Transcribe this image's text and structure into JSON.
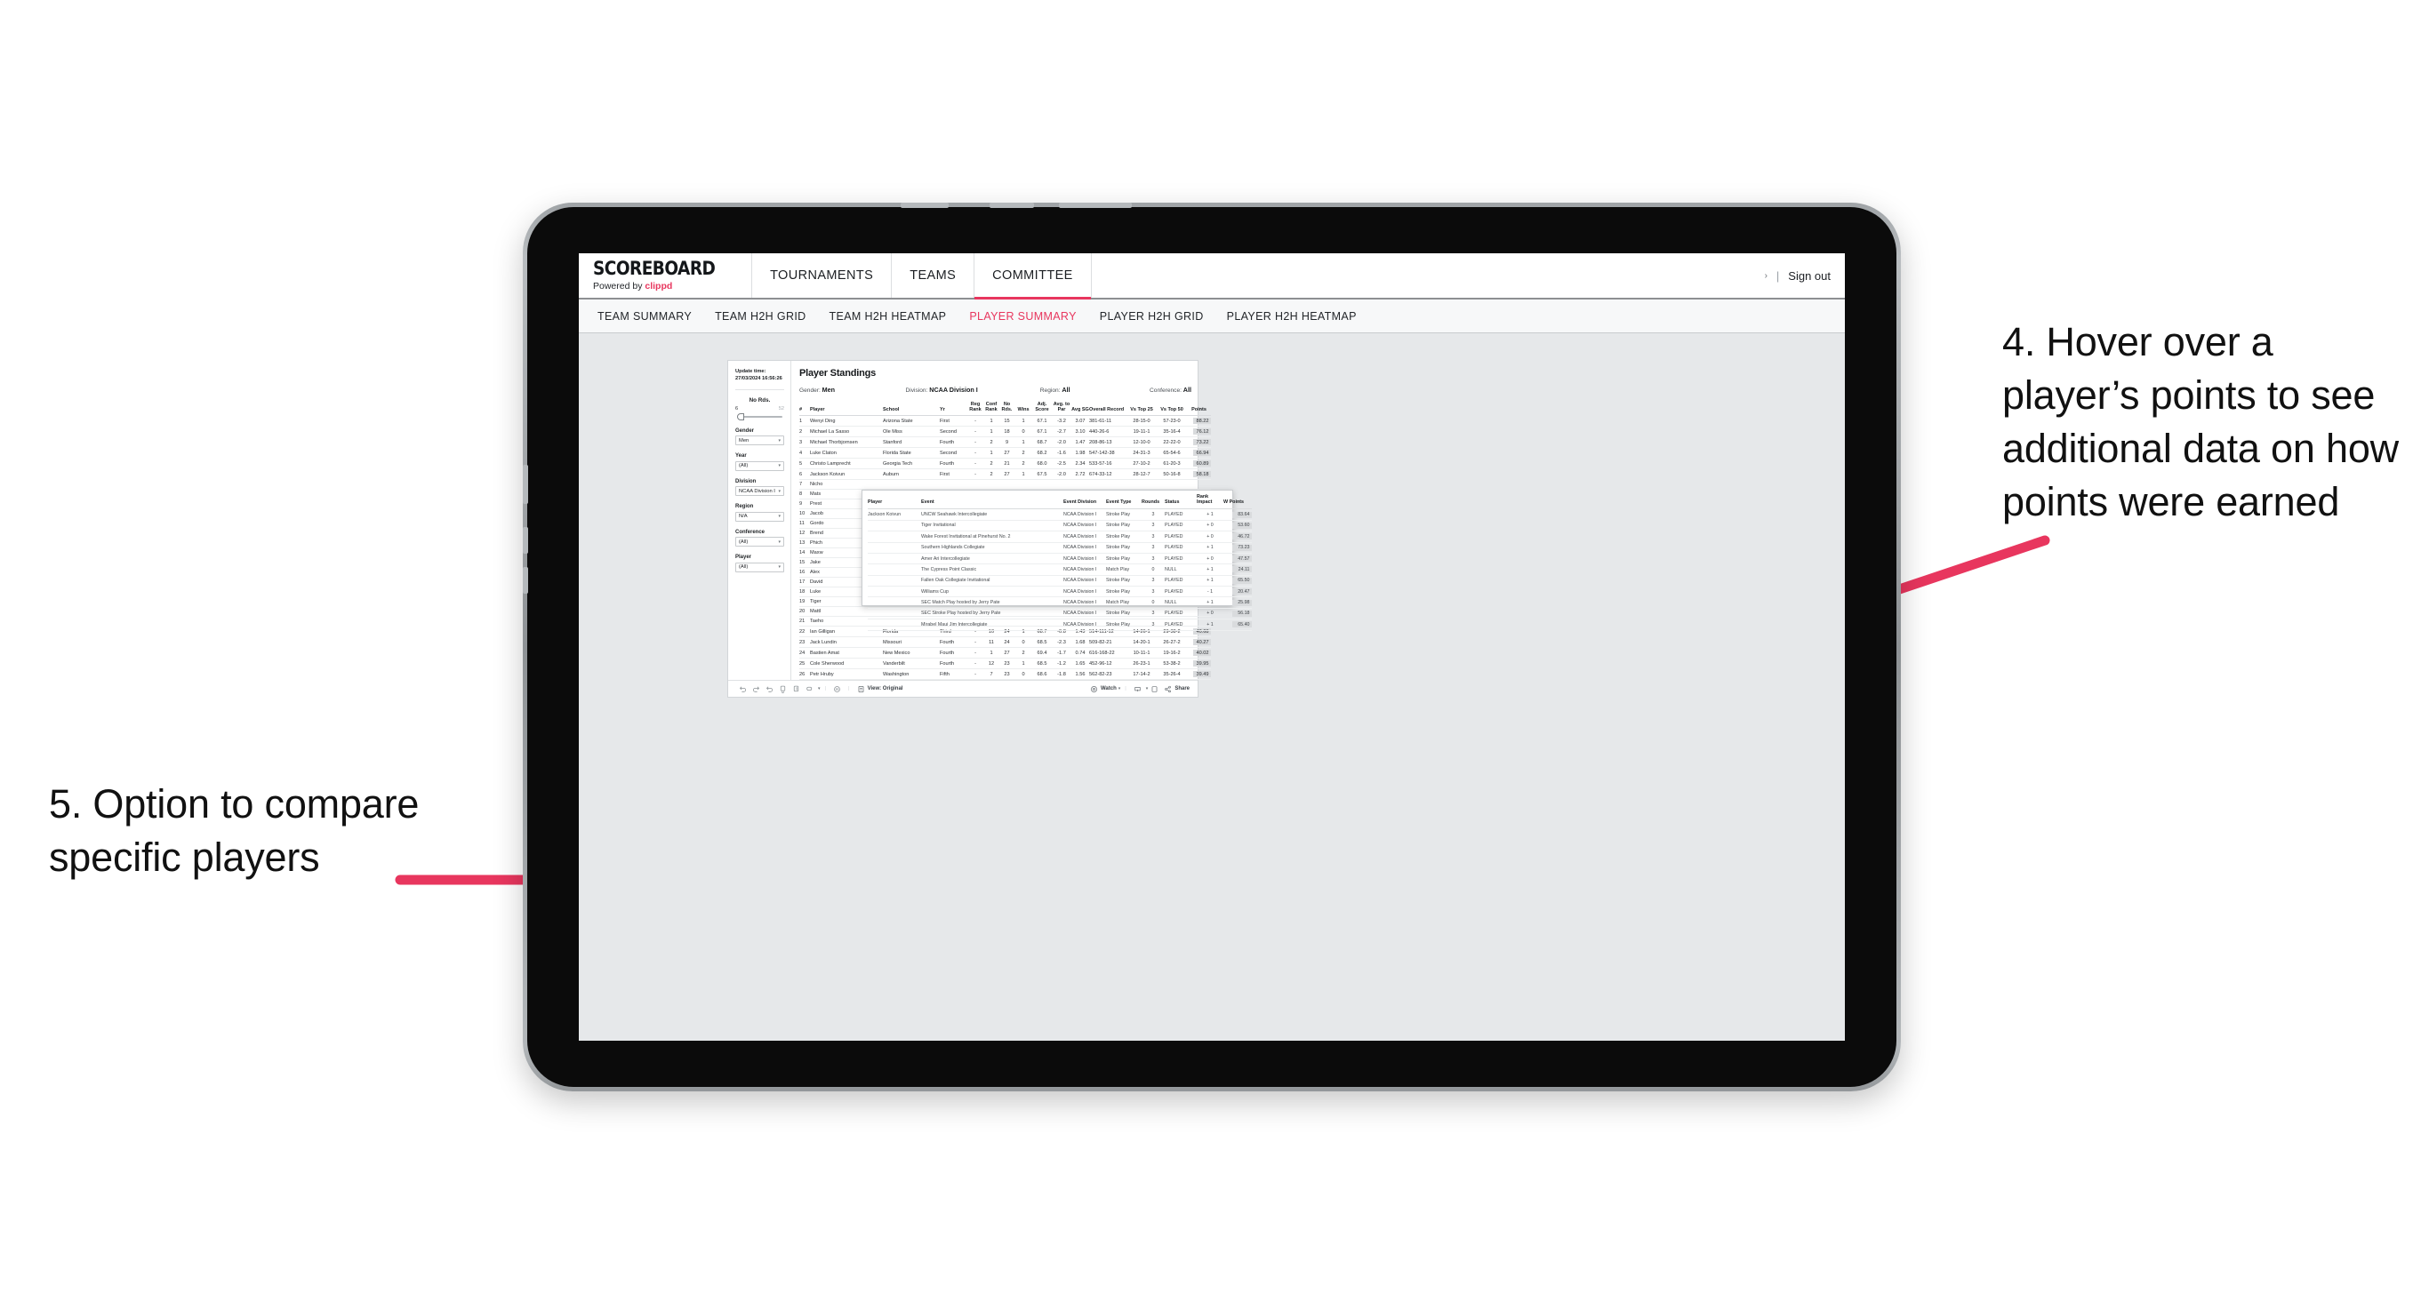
{
  "annotations": {
    "right": "4. Hover over a player’s points to see additional data on how points were earned",
    "left": "5. Option to compare specific players",
    "accent_color": "#E8365E"
  },
  "topnav": {
    "brand_title": "SCOREBOARD",
    "brand_powered": "Powered by",
    "brand_name": "clippd",
    "items": [
      {
        "label": "TOURNAMENTS",
        "active": false
      },
      {
        "label": "TEAMS",
        "active": false
      },
      {
        "label": "COMMITTEE",
        "active": true
      }
    ],
    "caret": "›",
    "separator": "|",
    "signout": "Sign out"
  },
  "subnav": {
    "items": [
      {
        "label": "TEAM SUMMARY",
        "active": false
      },
      {
        "label": "TEAM H2H GRID",
        "active": false
      },
      {
        "label": "TEAM H2H HEATMAP",
        "active": false
      },
      {
        "label": "PLAYER SUMMARY",
        "active": true
      },
      {
        "label": "PLAYER H2H GRID",
        "active": false
      },
      {
        "label": "PLAYER H2H HEATMAP",
        "active": false
      }
    ]
  },
  "filters": {
    "update_time_label": "Update time:",
    "update_time_value": "27/03/2024 16:56:26",
    "slider": {
      "label": "No Rds.",
      "min": "6",
      "max": "52"
    },
    "groups": [
      {
        "label": "Gender",
        "value": "Men"
      },
      {
        "label": "Year",
        "value": "(All)"
      },
      {
        "label": "Division",
        "value": "NCAA Division I"
      },
      {
        "label": "Region",
        "value": "N/A"
      },
      {
        "label": "Conference",
        "value": "(All)"
      },
      {
        "label": "Player",
        "value": "(All)"
      }
    ],
    "caret": "▾"
  },
  "panel": {
    "title": "Player Standings",
    "meta": [
      {
        "label": "Gender:",
        "value": "Men"
      },
      {
        "label": "Division:",
        "value": "NCAA Division I"
      },
      {
        "label": "Region:",
        "value": "All"
      },
      {
        "label": "Conference:",
        "value": "All"
      }
    ]
  },
  "standings": {
    "headers": [
      "#",
      "Player",
      "School",
      "Yr",
      "Reg Rank",
      "Conf Rank",
      "No Rds.",
      "Wins",
      "Adj. Score",
      "Avg. to Par",
      "Avg SG",
      "Overall Record",
      "Vs Top 25",
      "Vs Top 50",
      "Points"
    ],
    "rows": [
      {
        "n": "1",
        "player": "Wenyi Ding",
        "school": "Arizona State",
        "yr": "First",
        "reg": "-",
        "conf": "1",
        "rds": "15",
        "wins": "1",
        "adj": "67.1",
        "par": "-3.2",
        "sg": "3.07",
        "rec": "381-61-11",
        "t25": "28-15-0",
        "t50": "57-23-0",
        "pts": "88.22"
      },
      {
        "n": "2",
        "player": "Michael La Sasso",
        "school": "Ole Miss",
        "yr": "Second",
        "reg": "-",
        "conf": "1",
        "rds": "18",
        "wins": "0",
        "adj": "67.1",
        "par": "-2.7",
        "sg": "3.10",
        "rec": "440-26-6",
        "t25": "19-11-1",
        "t50": "35-16-4",
        "pts": "76.12"
      },
      {
        "n": "3",
        "player": "Michael Thorbjornsen",
        "school": "Stanford",
        "yr": "Fourth",
        "reg": "-",
        "conf": "2",
        "rds": "9",
        "wins": "1",
        "adj": "68.7",
        "par": "-2.0",
        "sg": "1.47",
        "rec": "208-86-13",
        "t25": "12-10-0",
        "t50": "22-22-0",
        "pts": "73.22"
      },
      {
        "n": "4",
        "player": "Luke Claton",
        "school": "Florida State",
        "yr": "Second",
        "reg": "-",
        "conf": "1",
        "rds": "27",
        "wins": "2",
        "adj": "68.2",
        "par": "-1.6",
        "sg": "1.98",
        "rec": "547-142-38",
        "t25": "24-31-3",
        "t50": "65-54-6",
        "pts": "66.94"
      },
      {
        "n": "5",
        "player": "Christo Lamprecht",
        "school": "Georgia Tech",
        "yr": "Fourth",
        "reg": "-",
        "conf": "2",
        "rds": "21",
        "wins": "2",
        "adj": "68.0",
        "par": "-2.5",
        "sg": "2.34",
        "rec": "533-57-16",
        "t25": "27-10-2",
        "t50": "61-20-3",
        "pts": "60.89"
      },
      {
        "n": "6",
        "player": "Jackson Koivun",
        "school": "Auburn",
        "yr": "First",
        "reg": "-",
        "conf": "2",
        "rds": "27",
        "wins": "1",
        "adj": "67.5",
        "par": "-2.0",
        "sg": "2.72",
        "rec": "674-33-12",
        "t25": "28-12-7",
        "t50": "50-16-8",
        "pts": "58.18"
      },
      {
        "n": "7",
        "player": "Nicho",
        "school": "",
        "yr": "",
        "reg": "",
        "conf": "",
        "rds": "",
        "wins": "",
        "adj": "",
        "par": "",
        "sg": "",
        "rec": "",
        "t25": "",
        "t50": "",
        "pts": ""
      },
      {
        "n": "8",
        "player": "Mats",
        "school": "",
        "yr": "",
        "reg": "",
        "conf": "",
        "rds": "",
        "wins": "",
        "adj": "",
        "par": "",
        "sg": "",
        "rec": "",
        "t25": "",
        "t50": "",
        "pts": ""
      },
      {
        "n": "9",
        "player": "Prest",
        "school": "",
        "yr": "",
        "reg": "",
        "conf": "",
        "rds": "",
        "wins": "",
        "adj": "",
        "par": "",
        "sg": "",
        "rec": "",
        "t25": "",
        "t50": "",
        "pts": ""
      },
      {
        "n": "10",
        "player": "Jacob",
        "school": "",
        "yr": "",
        "reg": "",
        "conf": "",
        "rds": "",
        "wins": "",
        "adj": "",
        "par": "",
        "sg": "",
        "rec": "",
        "t25": "",
        "t50": "",
        "pts": ""
      },
      {
        "n": "11",
        "player": "Gordo",
        "school": "",
        "yr": "",
        "reg": "",
        "conf": "",
        "rds": "",
        "wins": "",
        "adj": "",
        "par": "",
        "sg": "",
        "rec": "",
        "t25": "",
        "t50": "",
        "pts": ""
      },
      {
        "n": "12",
        "player": "Brend",
        "school": "",
        "yr": "",
        "reg": "",
        "conf": "",
        "rds": "",
        "wins": "",
        "adj": "",
        "par": "",
        "sg": "",
        "rec": "",
        "t25": "",
        "t50": "",
        "pts": ""
      },
      {
        "n": "13",
        "player": "Phich",
        "school": "",
        "yr": "",
        "reg": "",
        "conf": "",
        "rds": "",
        "wins": "",
        "adj": "",
        "par": "",
        "sg": "",
        "rec": "",
        "t25": "",
        "t50": "",
        "pts": ""
      },
      {
        "n": "14",
        "player": "Maxw",
        "school": "",
        "yr": "",
        "reg": "",
        "conf": "",
        "rds": "",
        "wins": "",
        "adj": "",
        "par": "",
        "sg": "",
        "rec": "",
        "t25": "",
        "t50": "",
        "pts": ""
      },
      {
        "n": "15",
        "player": "Jake",
        "school": "",
        "yr": "",
        "reg": "",
        "conf": "",
        "rds": "",
        "wins": "",
        "adj": "",
        "par": "",
        "sg": "",
        "rec": "",
        "t25": "",
        "t50": "",
        "pts": ""
      },
      {
        "n": "16",
        "player": "Alex",
        "school": "",
        "yr": "",
        "reg": "",
        "conf": "",
        "rds": "",
        "wins": "",
        "adj": "",
        "par": "",
        "sg": "",
        "rec": "",
        "t25": "",
        "t50": "",
        "pts": ""
      },
      {
        "n": "17",
        "player": "David",
        "school": "",
        "yr": "",
        "reg": "",
        "conf": "",
        "rds": "",
        "wins": "",
        "adj": "",
        "par": "",
        "sg": "",
        "rec": "",
        "t25": "",
        "t50": "",
        "pts": ""
      },
      {
        "n": "18",
        "player": "Luke",
        "school": "",
        "yr": "",
        "reg": "",
        "conf": "",
        "rds": "",
        "wins": "",
        "adj": "",
        "par": "",
        "sg": "",
        "rec": "",
        "t25": "",
        "t50": "",
        "pts": ""
      },
      {
        "n": "19",
        "player": "Tiger",
        "school": "",
        "yr": "",
        "reg": "",
        "conf": "",
        "rds": "",
        "wins": "",
        "adj": "",
        "par": "",
        "sg": "",
        "rec": "",
        "t25": "",
        "t50": "",
        "pts": ""
      },
      {
        "n": "20",
        "player": "Mattl",
        "school": "",
        "yr": "",
        "reg": "",
        "conf": "",
        "rds": "",
        "wins": "",
        "adj": "",
        "par": "",
        "sg": "",
        "rec": "",
        "t25": "",
        "t50": "",
        "pts": ""
      },
      {
        "n": "21",
        "player": "Taeho",
        "school": "",
        "yr": "",
        "reg": "",
        "conf": "",
        "rds": "",
        "wins": "",
        "adj": "",
        "par": "",
        "sg": "",
        "rec": "",
        "t25": "",
        "t50": "",
        "pts": ""
      },
      {
        "n": "22",
        "player": "Ian Gilligan",
        "school": "Florida",
        "yr": "Third",
        "reg": "-",
        "conf": "10",
        "rds": "24",
        "wins": "1",
        "adj": "68.7",
        "par": "-0.8",
        "sg": "1.43",
        "rec": "514-111-12",
        "t25": "14-26-1",
        "t50": "29-38-2",
        "pts": "40.68"
      },
      {
        "n": "23",
        "player": "Jack Lundin",
        "school": "Missouri",
        "yr": "Fourth",
        "reg": "-",
        "conf": "11",
        "rds": "24",
        "wins": "0",
        "adj": "68.5",
        "par": "-2.3",
        "sg": "1.68",
        "rec": "509-82-21",
        "t25": "14-20-1",
        "t50": "26-27-2",
        "pts": "40.27"
      },
      {
        "n": "24",
        "player": "Bastien Amat",
        "school": "New Mexico",
        "yr": "Fourth",
        "reg": "-",
        "conf": "1",
        "rds": "27",
        "wins": "2",
        "adj": "69.4",
        "par": "-1.7",
        "sg": "0.74",
        "rec": "616-168-22",
        "t25": "10-11-1",
        "t50": "19-16-2",
        "pts": "40.02"
      },
      {
        "n": "25",
        "player": "Cole Sherwood",
        "school": "Vanderbilt",
        "yr": "Fourth",
        "reg": "-",
        "conf": "12",
        "rds": "23",
        "wins": "1",
        "adj": "68.5",
        "par": "-1.2",
        "sg": "1.65",
        "rec": "452-96-12",
        "t25": "26-23-1",
        "t50": "53-38-2",
        "pts": "39.95"
      },
      {
        "n": "26",
        "player": "Petr Hruby",
        "school": "Washington",
        "yr": "Fifth",
        "reg": "-",
        "conf": "7",
        "rds": "23",
        "wins": "0",
        "adj": "68.6",
        "par": "-1.8",
        "sg": "1.56",
        "rec": "562-82-23",
        "t25": "17-14-2",
        "t50": "35-26-4",
        "pts": "39.49"
      }
    ]
  },
  "tooltip": {
    "headers": [
      "Player",
      "Event",
      "Event Division",
      "Event Type",
      "Rounds",
      "Status",
      "Rank Impact",
      "W Points"
    ],
    "player": "Jackson Koivun",
    "rows": [
      {
        "event": "UNCW Seahawk Intercollegiate",
        "division": "NCAA Division I",
        "type": "Stroke Play",
        "rounds": "3",
        "status": "PLAYED",
        "impact": "+ 1",
        "wpoints": "83.64"
      },
      {
        "event": "Tiger Invitational",
        "division": "NCAA Division I",
        "type": "Stroke Play",
        "rounds": "3",
        "status": "PLAYED",
        "impact": "+ 0",
        "wpoints": "53.60"
      },
      {
        "event": "Wake Forest Invitational at Pinehurst No. 2",
        "division": "NCAA Division I",
        "type": "Stroke Play",
        "rounds": "3",
        "status": "PLAYED",
        "impact": "+ 0",
        "wpoints": "46.72"
      },
      {
        "event": "Southern Highlands Collegiate",
        "division": "NCAA Division I",
        "type": "Stroke Play",
        "rounds": "3",
        "status": "PLAYED",
        "impact": "+ 1",
        "wpoints": "73.23"
      },
      {
        "event": "Amer Ari Intercollegiate",
        "division": "NCAA Division I",
        "type": "Stroke Play",
        "rounds": "3",
        "status": "PLAYED",
        "impact": "+ 0",
        "wpoints": "47.57"
      },
      {
        "event": "The Cypress Point Classic",
        "division": "NCAA Division I",
        "type": "Match Play",
        "rounds": "0",
        "status": "NULL",
        "impact": "+ 1",
        "wpoints": "24.11"
      },
      {
        "event": "Fallen Oak Collegiate Invitational",
        "division": "NCAA Division I",
        "type": "Stroke Play",
        "rounds": "3",
        "status": "PLAYED",
        "impact": "+ 1",
        "wpoints": "65.50"
      },
      {
        "event": "Williams Cup",
        "division": "NCAA Division I",
        "type": "Stroke Play",
        "rounds": "3",
        "status": "PLAYED",
        "impact": "- 1",
        "wpoints": "20.47"
      },
      {
        "event": "SEC Match Play hosted by Jerry Pate",
        "division": "NCAA Division I",
        "type": "Match Play",
        "rounds": "0",
        "status": "NULL",
        "impact": "+ 1",
        "wpoints": "25.98"
      },
      {
        "event": "SEC Stroke Play hosted by Jerry Pate",
        "division": "NCAA Division I",
        "type": "Stroke Play",
        "rounds": "3",
        "status": "PLAYED",
        "impact": "+ 0",
        "wpoints": "56.18"
      },
      {
        "event": "Mirabel Maui Jim Intercollegiate",
        "division": "NCAA Division I",
        "type": "Stroke Play",
        "rounds": "3",
        "status": "PLAYED",
        "impact": "+ 1",
        "wpoints": "65.40"
      }
    ]
  },
  "toolbar": {
    "view_label": "View: Original",
    "watch_label": "Watch",
    "share_label": "Share",
    "caret": "▾",
    "separator": "|"
  }
}
